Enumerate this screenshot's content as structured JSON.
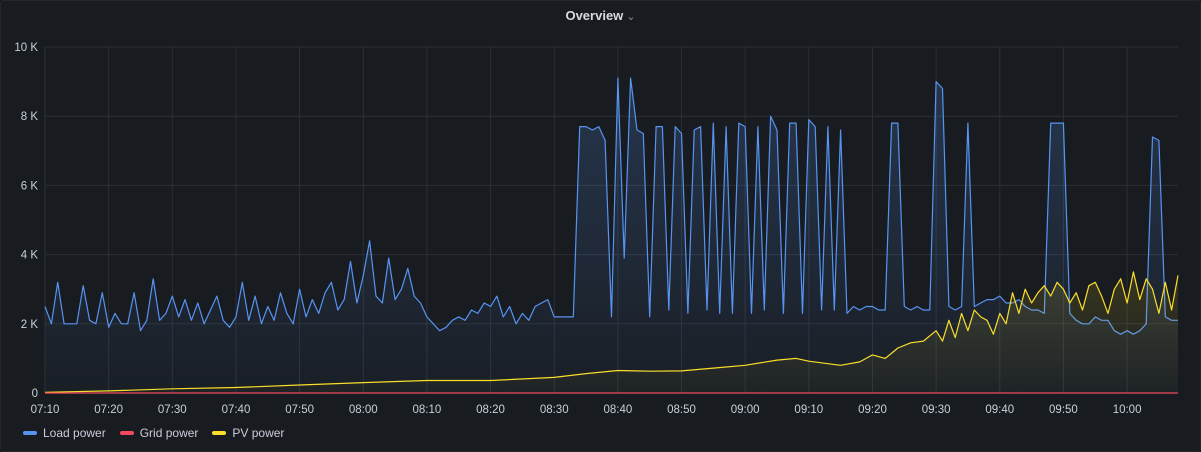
{
  "panel": {
    "title": "Overview",
    "chevron": "chevron-down-icon"
  },
  "chart_data": {
    "type": "area",
    "ylim": [
      0,
      10000
    ],
    "y_ticks": [
      0,
      2000,
      4000,
      6000,
      8000,
      10000
    ],
    "y_tick_labels": [
      "0",
      "2 K",
      "4 K",
      "6 K",
      "8 K",
      "10 K"
    ],
    "x_range_minutes": [
      "07:10",
      "10:08"
    ],
    "x_tick_labels": [
      "07:10",
      "07:20",
      "07:30",
      "07:40",
      "07:50",
      "08:00",
      "08:10",
      "08:20",
      "08:30",
      "08:40",
      "08:50",
      "09:00",
      "09:10",
      "09:20",
      "09:30",
      "09:40",
      "09:50",
      "10:00"
    ],
    "grid": true,
    "legend_position": "bottom-left",
    "series": [
      {
        "name": "Load power",
        "color": "#5794f2",
        "points": [
          [
            "07:10",
            2500
          ],
          [
            "07:11",
            2000
          ],
          [
            "07:12",
            3200
          ],
          [
            "07:13",
            2000
          ],
          [
            "07:15",
            2000
          ],
          [
            "07:16",
            3100
          ],
          [
            "07:17",
            2100
          ],
          [
            "07:18",
            2000
          ],
          [
            "07:19",
            2900
          ],
          [
            "07:20",
            1900
          ],
          [
            "07:21",
            2300
          ],
          [
            "07:22",
            2000
          ],
          [
            "07:23",
            2000
          ],
          [
            "07:24",
            2900
          ],
          [
            "07:25",
            1800
          ],
          [
            "07:26",
            2100
          ],
          [
            "07:27",
            3300
          ],
          [
            "07:28",
            2100
          ],
          [
            "07:29",
            2300
          ],
          [
            "07:30",
            2800
          ],
          [
            "07:31",
            2200
          ],
          [
            "07:32",
            2700
          ],
          [
            "07:33",
            2100
          ],
          [
            "07:34",
            2600
          ],
          [
            "07:35",
            2000
          ],
          [
            "07:36",
            2400
          ],
          [
            "07:37",
            2800
          ],
          [
            "07:38",
            2100
          ],
          [
            "07:39",
            1900
          ],
          [
            "07:40",
            2200
          ],
          [
            "07:41",
            3200
          ],
          [
            "07:42",
            2100
          ],
          [
            "07:43",
            2800
          ],
          [
            "07:44",
            2000
          ],
          [
            "07:45",
            2500
          ],
          [
            "07:46",
            2100
          ],
          [
            "07:47",
            2900
          ],
          [
            "07:48",
            2300
          ],
          [
            "07:49",
            2000
          ],
          [
            "07:50",
            3000
          ],
          [
            "07:51",
            2200
          ],
          [
            "07:52",
            2700
          ],
          [
            "07:53",
            2300
          ],
          [
            "07:54",
            2900
          ],
          [
            "07:55",
            3200
          ],
          [
            "07:56",
            2400
          ],
          [
            "07:57",
            2700
          ],
          [
            "07:58",
            3800
          ],
          [
            "07:59",
            2600
          ],
          [
            "08:00",
            3400
          ],
          [
            "08:01",
            4400
          ],
          [
            "08:02",
            2800
          ],
          [
            "08:03",
            2600
          ],
          [
            "08:04",
            3900
          ],
          [
            "08:05",
            2700
          ],
          [
            "08:06",
            3000
          ],
          [
            "08:07",
            3600
          ],
          [
            "08:08",
            2800
          ],
          [
            "08:09",
            2600
          ],
          [
            "08:10",
            2200
          ],
          [
            "08:11",
            2000
          ],
          [
            "08:12",
            1800
          ],
          [
            "08:13",
            1900
          ],
          [
            "08:14",
            2100
          ],
          [
            "08:15",
            2200
          ],
          [
            "08:16",
            2100
          ],
          [
            "08:17",
            2400
          ],
          [
            "08:18",
            2300
          ],
          [
            "08:19",
            2600
          ],
          [
            "08:20",
            2500
          ],
          [
            "08:21",
            2800
          ],
          [
            "08:22",
            2200
          ],
          [
            "08:23",
            2500
          ],
          [
            "08:24",
            2000
          ],
          [
            "08:25",
            2300
          ],
          [
            "08:26",
            2100
          ],
          [
            "08:27",
            2500
          ],
          [
            "08:28",
            2600
          ],
          [
            "08:29",
            2700
          ],
          [
            "08:30",
            2200
          ],
          [
            "08:31",
            2200
          ],
          [
            "08:32",
            2200
          ],
          [
            "08:33",
            2200
          ],
          [
            "08:34",
            7700
          ],
          [
            "08:35",
            7700
          ],
          [
            "08:36",
            7600
          ],
          [
            "08:37",
            7700
          ],
          [
            "08:38",
            7300
          ],
          [
            "08:39",
            2200
          ],
          [
            "08:40",
            9100
          ],
          [
            "08:41",
            3900
          ],
          [
            "08:42",
            9100
          ],
          [
            "08:43",
            7600
          ],
          [
            "08:44",
            7500
          ],
          [
            "08:45",
            2200
          ],
          [
            "08:46",
            7700
          ],
          [
            "08:47",
            7700
          ],
          [
            "08:48",
            2400
          ],
          [
            "08:49",
            7700
          ],
          [
            "08:50",
            7500
          ],
          [
            "08:51",
            2300
          ],
          [
            "08:52",
            7600
          ],
          [
            "08:53",
            7700
          ],
          [
            "08:54",
            2400
          ],
          [
            "08:55",
            7800
          ],
          [
            "08:56",
            2300
          ],
          [
            "08:57",
            7700
          ],
          [
            "08:58",
            2300
          ],
          [
            "08:59",
            7800
          ],
          [
            "09:00",
            7700
          ],
          [
            "09:01",
            2300
          ],
          [
            "09:02",
            7700
          ],
          [
            "09:03",
            2400
          ],
          [
            "09:04",
            8000
          ],
          [
            "09:05",
            7600
          ],
          [
            "09:06",
            2300
          ],
          [
            "09:07",
            7800
          ],
          [
            "09:08",
            7800
          ],
          [
            "09:09",
            2300
          ],
          [
            "09:10",
            7900
          ],
          [
            "09:11",
            7700
          ],
          [
            "09:12",
            2400
          ],
          [
            "09:13",
            7700
          ],
          [
            "09:14",
            2400
          ],
          [
            "09:15",
            7600
          ],
          [
            "09:16",
            2300
          ],
          [
            "09:17",
            2500
          ],
          [
            "09:18",
            2400
          ],
          [
            "09:19",
            2500
          ],
          [
            "09:20",
            2500
          ],
          [
            "09:21",
            2400
          ],
          [
            "09:22",
            2400
          ],
          [
            "09:23",
            7800
          ],
          [
            "09:24",
            7800
          ],
          [
            "09:25",
            2500
          ],
          [
            "09:26",
            2400
          ],
          [
            "09:27",
            2500
          ],
          [
            "09:28",
            2400
          ],
          [
            "09:29",
            2400
          ],
          [
            "09:30",
            9000
          ],
          [
            "09:31",
            8800
          ],
          [
            "09:32",
            2500
          ],
          [
            "09:33",
            2400
          ],
          [
            "09:34",
            2500
          ],
          [
            "09:35",
            7800
          ],
          [
            "09:36",
            2500
          ],
          [
            "09:37",
            2600
          ],
          [
            "09:38",
            2700
          ],
          [
            "09:39",
            2700
          ],
          [
            "09:40",
            2800
          ],
          [
            "09:41",
            2600
          ],
          [
            "09:42",
            2600
          ],
          [
            "09:43",
            2700
          ],
          [
            "09:44",
            2500
          ],
          [
            "09:45",
            2400
          ],
          [
            "09:46",
            2400
          ],
          [
            "09:47",
            2300
          ],
          [
            "09:48",
            7800
          ],
          [
            "09:49",
            7800
          ],
          [
            "09:50",
            7800
          ],
          [
            "09:51",
            2300
          ],
          [
            "09:52",
            2100
          ],
          [
            "09:53",
            2000
          ],
          [
            "09:54",
            2000
          ],
          [
            "09:55",
            2200
          ],
          [
            "09:56",
            2100
          ],
          [
            "09:57",
            2100
          ],
          [
            "09:58",
            1800
          ],
          [
            "09:59",
            1700
          ],
          [
            "10:00",
            1800
          ],
          [
            "10:01",
            1700
          ],
          [
            "10:02",
            1800
          ],
          [
            "10:03",
            2000
          ],
          [
            "10:04",
            7400
          ],
          [
            "10:05",
            7300
          ],
          [
            "10:06",
            2200
          ],
          [
            "10:07",
            2100
          ],
          [
            "10:08",
            2100
          ]
        ]
      },
      {
        "name": "Grid power",
        "color": "#f2495c",
        "points": [
          [
            "07:10",
            0
          ],
          [
            "10:08",
            0
          ]
        ]
      },
      {
        "name": "PV power",
        "color": "#fade2a",
        "points": [
          [
            "07:10",
            20
          ],
          [
            "07:20",
            60
          ],
          [
            "07:30",
            120
          ],
          [
            "07:40",
            160
          ],
          [
            "07:50",
            230
          ],
          [
            "08:00",
            300
          ],
          [
            "08:10",
            360
          ],
          [
            "08:20",
            360
          ],
          [
            "08:30",
            450
          ],
          [
            "08:35",
            560
          ],
          [
            "08:40",
            650
          ],
          [
            "08:45",
            630
          ],
          [
            "08:50",
            640
          ],
          [
            "08:55",
            720
          ],
          [
            "09:00",
            800
          ],
          [
            "09:05",
            950
          ],
          [
            "09:08",
            1000
          ],
          [
            "09:10",
            920
          ],
          [
            "09:15",
            800
          ],
          [
            "09:18",
            900
          ],
          [
            "09:20",
            1100
          ],
          [
            "09:22",
            1000
          ],
          [
            "09:24",
            1300
          ],
          [
            "09:26",
            1450
          ],
          [
            "09:28",
            1500
          ],
          [
            "09:30",
            1800
          ],
          [
            "09:31",
            1500
          ],
          [
            "09:32",
            2100
          ],
          [
            "09:33",
            1600
          ],
          [
            "09:34",
            2300
          ],
          [
            "09:35",
            1800
          ],
          [
            "09:36",
            2400
          ],
          [
            "09:37",
            2200
          ],
          [
            "09:38",
            2100
          ],
          [
            "09:39",
            1700
          ],
          [
            "09:40",
            2300
          ],
          [
            "09:41",
            2000
          ],
          [
            "09:42",
            2900
          ],
          [
            "09:43",
            2300
          ],
          [
            "09:44",
            3000
          ],
          [
            "09:45",
            2600
          ],
          [
            "09:46",
            2900
          ],
          [
            "09:47",
            3100
          ],
          [
            "09:48",
            2800
          ],
          [
            "09:49",
            3200
          ],
          [
            "09:50",
            3000
          ],
          [
            "09:51",
            2600
          ],
          [
            "09:52",
            2900
          ],
          [
            "09:53",
            2400
          ],
          [
            "09:54",
            3100
          ],
          [
            "09:55",
            3200
          ],
          [
            "09:56",
            2800
          ],
          [
            "09:57",
            2300
          ],
          [
            "09:58",
            3000
          ],
          [
            "09:59",
            3300
          ],
          [
            "10:00",
            2600
          ],
          [
            "10:01",
            3500
          ],
          [
            "10:02",
            2700
          ],
          [
            "10:03",
            3300
          ],
          [
            "10:04",
            3000
          ],
          [
            "10:05",
            2300
          ],
          [
            "10:06",
            3200
          ],
          [
            "10:07",
            2400
          ],
          [
            "10:08",
            3400
          ]
        ]
      }
    ]
  },
  "legend": [
    {
      "label": "Load power",
      "color": "#5794f2"
    },
    {
      "label": "Grid power",
      "color": "#f2495c"
    },
    {
      "label": "PV power",
      "color": "#fade2a"
    }
  ]
}
